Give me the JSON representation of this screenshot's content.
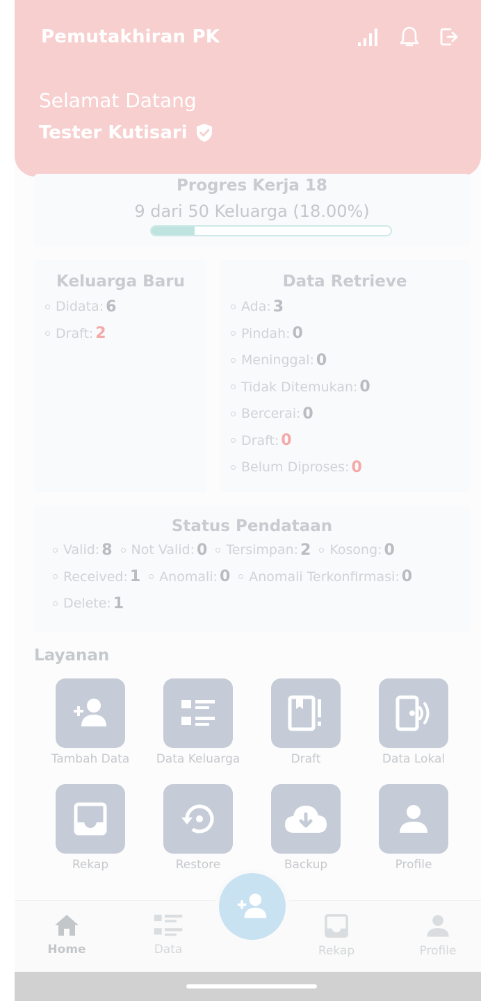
{
  "header": {
    "app_title": "Pemutakhiran PK",
    "welcome": "Selamat Datang",
    "user_name": "Tester Kutisari",
    "icons": [
      "signal-icon",
      "bell-icon",
      "logout-icon",
      "verified-icon"
    ]
  },
  "progress": {
    "title": "Progres Kerja 18",
    "text": "9 dari 50 Keluarga (18.00%)",
    "fraction": 0.18
  },
  "keluarga_baru": {
    "title": "Keluarga Baru",
    "items": [
      {
        "label": "Didata:",
        "value": "6"
      },
      {
        "label": "Draft:",
        "value": "2"
      }
    ]
  },
  "data_retrieve": {
    "title": "Data Retrieve",
    "items": [
      {
        "label": "Ada:",
        "value": "3"
      },
      {
        "label": "Pindah:",
        "value": "0"
      },
      {
        "label": "Meninggal:",
        "value": "0"
      },
      {
        "label": "Tidak Ditemukan:",
        "value": "0"
      },
      {
        "label": "Bercerai:",
        "value": "0"
      },
      {
        "label": "Draft:",
        "value": "0"
      },
      {
        "label": "Belum Diproses:",
        "value": "0"
      }
    ]
  },
  "status": {
    "title": "Status Pendataan",
    "row1": [
      {
        "label": "Valid:",
        "value": "8"
      },
      {
        "label": "Not Valid:",
        "value": "0"
      },
      {
        "label": "Tersimpan:",
        "value": "2"
      },
      {
        "label": "Kosong:",
        "value": "0"
      }
    ],
    "row2": [
      {
        "label": "Received:",
        "value": "1"
      },
      {
        "label": "Anomali:",
        "value": "0"
      },
      {
        "label": "Anomali Terkonfirmasi:",
        "value": "0"
      }
    ],
    "row3": [
      {
        "label": "Delete:",
        "value": "1"
      }
    ]
  },
  "layanan": {
    "title": "Layanan",
    "items": [
      {
        "label": "Tambah Data",
        "icon": "add-person-icon"
      },
      {
        "label": "Data Keluarga",
        "icon": "list-icon"
      },
      {
        "label": "Draft",
        "icon": "draft-book-icon"
      },
      {
        "label": "Data Lokal",
        "icon": "phone-signal-icon"
      },
      {
        "label": "Rekap",
        "icon": "inbox-icon"
      },
      {
        "label": "Restore",
        "icon": "restore-icon"
      },
      {
        "label": "Backup",
        "icon": "cloud-download-icon"
      },
      {
        "label": "Profile",
        "icon": "person-icon"
      }
    ]
  },
  "nav": {
    "items": [
      {
        "label": "Home",
        "icon": "home-icon",
        "active": true
      },
      {
        "label": "Data",
        "icon": "list-icon"
      },
      {
        "label": "Rekap",
        "icon": "inbox-icon"
      },
      {
        "label": "Profile",
        "icon": "person-icon"
      }
    ],
    "fab_icon": "add-person-icon"
  },
  "colors": {
    "header": "#f8cfcf",
    "tile": "#c5ccd7",
    "fab": "#c9e2f2",
    "progress": "#bfe3df",
    "accent_red": "#f5a9a9"
  }
}
